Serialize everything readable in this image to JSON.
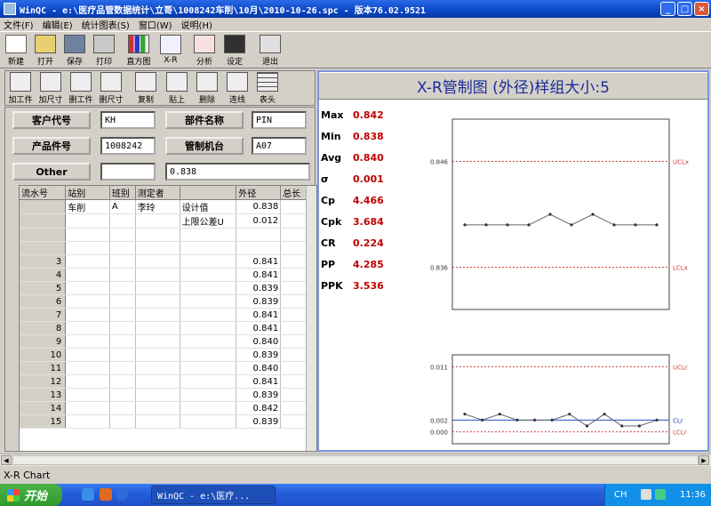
{
  "window": {
    "title": "WinQC - e:\\医疗品管数据统计\\立哥\\1008242车削\\10月\\2010-10-26.spc - 版本76.02.9521",
    "minimize": "_",
    "maximize": "□",
    "close": "×"
  },
  "menu": [
    "文件(F)",
    "编辑(E)",
    "统计图表(S)",
    "窗口(W)",
    "说明(H)"
  ],
  "toolbar": {
    "new": "新建",
    "open": "打开",
    "save": "保存",
    "print": "打印",
    "histogram": "直方图",
    "xr": "X-R",
    "analysis": "分析",
    "settings": "设定",
    "exit": "退出"
  },
  "toolbar2": {
    "add_part": "加工件",
    "add_size": "加尺寸",
    "del_part": "删工件",
    "del_size": "删尺寸",
    "copy": "复制",
    "paste": "贴上",
    "delete": "删除",
    "connect": "连线",
    "header": "表头"
  },
  "form": {
    "customer_label": "客户代号",
    "customer_value": "KH",
    "part_name_label": "部件名称",
    "part_name_value": "PIN",
    "part_no_label": "产品件号",
    "part_no_value": "1008242",
    "machine_label": "管制机台",
    "machine_value": "A07",
    "other_label": "Other",
    "other_value": "",
    "other_extra": "0.838"
  },
  "grid": {
    "headers": [
      "流水号",
      "站别",
      "班别",
      "测定者",
      "",
      "外径",
      "总长"
    ],
    "info_rows": [
      {
        "station": "车削",
        "shift": "A",
        "inspector": "李玲",
        "item": "设计值",
        "value": "0.838"
      },
      {
        "station": "",
        "shift": "",
        "inspector": "",
        "item": "上限公差U",
        "value": "0.012"
      }
    ],
    "rows": [
      {
        "no": "3",
        "value": "0.841"
      },
      {
        "no": "4",
        "value": "0.841"
      },
      {
        "no": "5",
        "value": "0.839"
      },
      {
        "no": "6",
        "value": "0.839"
      },
      {
        "no": "7",
        "value": "0.841"
      },
      {
        "no": "8",
        "value": "0.841"
      },
      {
        "no": "9",
        "value": "0.840"
      },
      {
        "no": "10",
        "value": "0.839"
      },
      {
        "no": "11",
        "value": "0.840"
      },
      {
        "no": "12",
        "value": "0.841"
      },
      {
        "no": "13",
        "value": "0.839"
      },
      {
        "no": "14",
        "value": "0.842"
      },
      {
        "no": "15",
        "value": "0.839"
      }
    ]
  },
  "chart": {
    "title": "X-R管制图 (外径)样组大小:5",
    "stats": [
      {
        "label": "Max",
        "value": "0.842"
      },
      {
        "label": "Min",
        "value": "0.838"
      },
      {
        "label": "Avg",
        "value": "0.840"
      },
      {
        "label": "σ",
        "value": "0.001"
      },
      {
        "label": "Cp",
        "value": "4.466"
      },
      {
        "label": "Cpk",
        "value": "3.684"
      },
      {
        "label": "CR",
        "value": "0.224"
      },
      {
        "label": "PP",
        "value": "4.285"
      },
      {
        "label": "PPK",
        "value": "3.536"
      }
    ],
    "xbar": {
      "ucl_label": "UCLx",
      "lcl_label": "LCLx",
      "ucl_value": "0.846",
      "lcl_value": "0.836",
      "ucl": 0.846,
      "lcl": 0.836,
      "ymin": 0.832,
      "ymax": 0.85,
      "values": [
        0.84,
        0.84,
        0.84,
        0.84,
        0.841,
        0.84,
        0.841,
        0.84,
        0.84,
        0.84
      ]
    },
    "range": {
      "ucl_label": "UCLr",
      "cl_label": "CLr",
      "lcl_label": "LCLr",
      "ucl_value": "0.011",
      "cl_value": "0.002",
      "lcl_value": "0.000",
      "ucl": 0.011,
      "cl": 0.002,
      "lcl": 0.0,
      "ymin": -0.002,
      "ymax": 0.013,
      "values": [
        0.003,
        0.002,
        0.003,
        0.002,
        0.002,
        0.002,
        0.003,
        0.001,
        0.003,
        0.001,
        0.001,
        0.002
      ]
    },
    "colors": {
      "limit": "#d04040",
      "center": "#2050c0",
      "line": "#606070"
    }
  },
  "status": {
    "text": "X-R Chart"
  },
  "taskbar": {
    "start": "开始",
    "task": "WinQC - e:\\医疗...",
    "lang": "CH",
    "clock": "11:36"
  }
}
